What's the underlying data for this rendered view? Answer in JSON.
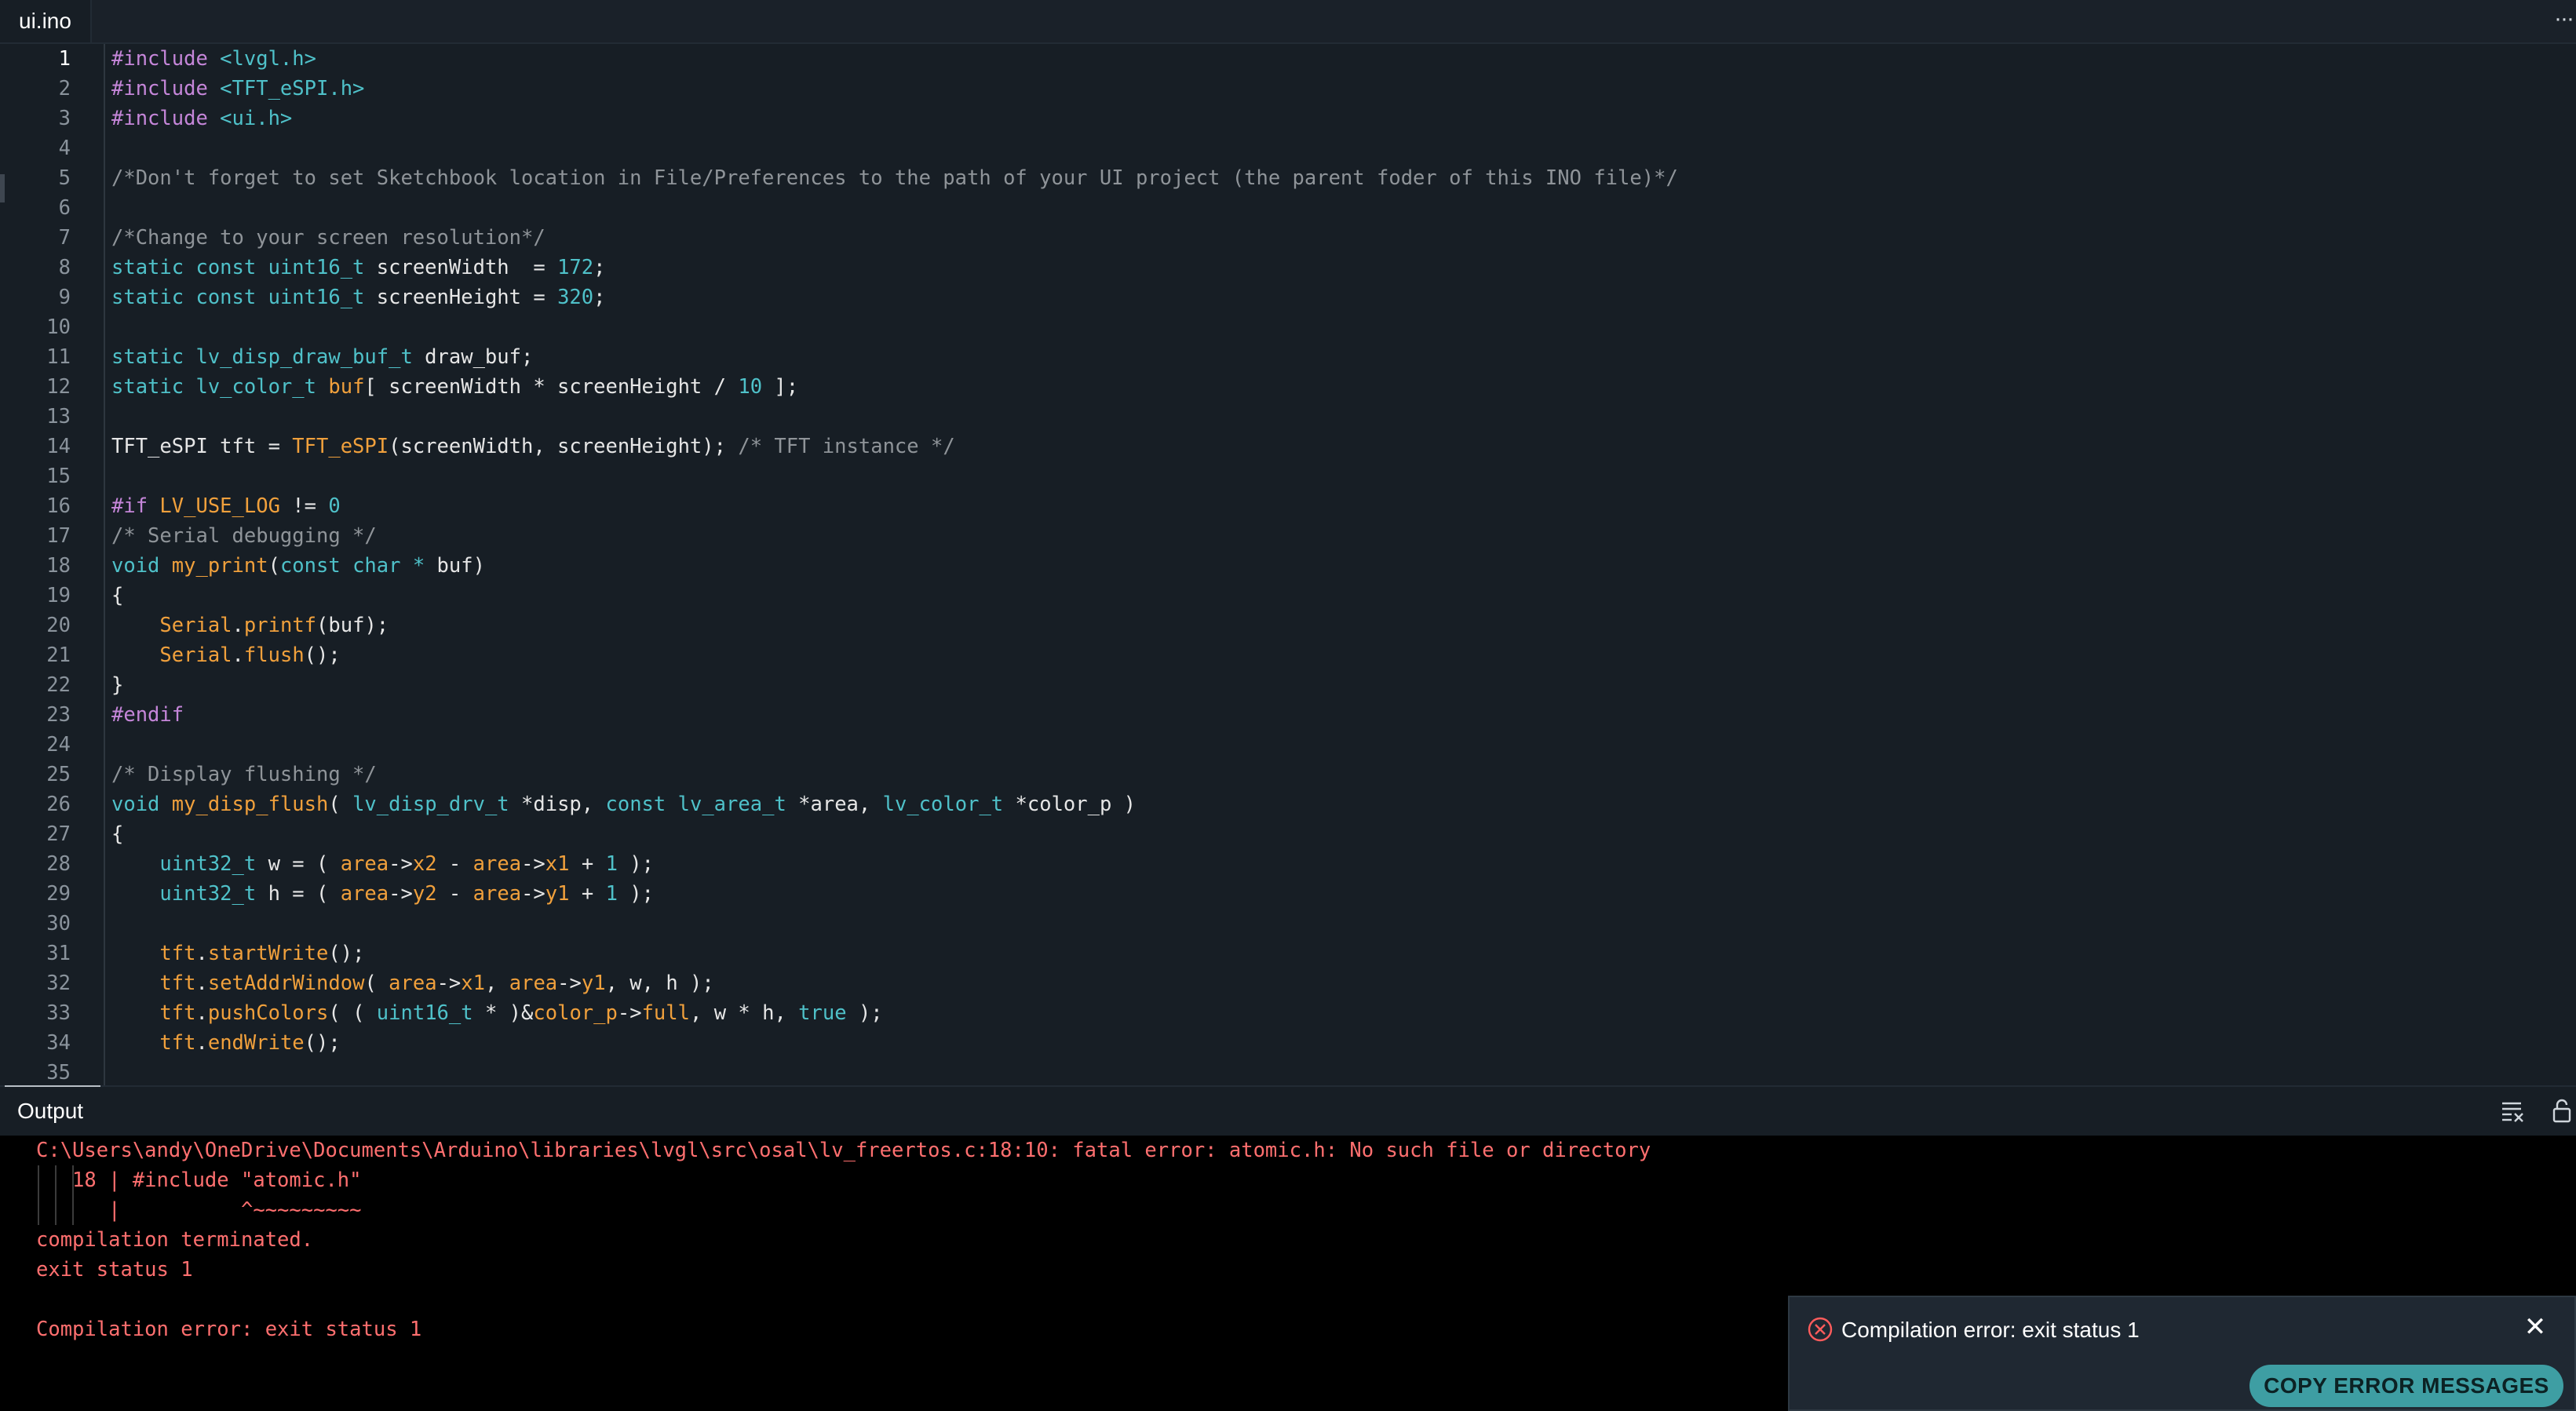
{
  "tab": {
    "label": "ui.ino"
  },
  "output_panel": {
    "title": "Output",
    "lines": [
      "C:\\Users\\andy\\OneDrive\\Documents\\Arduino\\libraries\\lvgl\\src\\osal\\lv_freertos.c:18:10: fatal error: atomic.h: No such file or directory",
      "   18 | #include \"atomic.h\"",
      "      |          ^~~~~~~~~~",
      "compilation terminated.",
      "exit status 1",
      "",
      "Compilation error: exit status 1"
    ]
  },
  "toast": {
    "message": "Compilation error: exit status 1",
    "button_label": "COPY ERROR MESSAGES"
  },
  "colors": {
    "editor_bg": "#171e25",
    "output_bg": "#000000",
    "error_text": "#ff6f6f",
    "button_bg": "#3e9ea3"
  },
  "icons": [
    "more-icon",
    "clear-output-icon",
    "lock-icon",
    "error-circle-icon",
    "close-icon"
  ],
  "editor": {
    "active_line": 1,
    "lines": [
      [
        [
          "inc",
          "#include "
        ],
        [
          "str",
          "<lvgl.h>"
        ]
      ],
      [
        [
          "inc",
          "#include "
        ],
        [
          "str",
          "<TFT_eSPI.h>"
        ]
      ],
      [
        [
          "inc",
          "#include "
        ],
        [
          "str",
          "<ui.h>"
        ]
      ],
      [],
      [
        [
          "com",
          "/*Don't forget to set Sketchbook location in File/Preferences to the path of your UI project (the parent foder of this INO file)*/"
        ]
      ],
      [],
      [
        [
          "com",
          "/*Change to your screen resolution*/"
        ]
      ],
      [
        [
          "kw",
          "static const "
        ],
        [
          "typ",
          "uint16_t"
        ],
        [
          "def",
          " screenWidth  = "
        ],
        [
          "num",
          "172"
        ],
        [
          "def",
          ";"
        ]
      ],
      [
        [
          "kw",
          "static const "
        ],
        [
          "typ",
          "uint16_t"
        ],
        [
          "def",
          " screenHeight = "
        ],
        [
          "num",
          "320"
        ],
        [
          "def",
          ";"
        ]
      ],
      [],
      [
        [
          "kw",
          "static "
        ],
        [
          "typ",
          "lv_disp_draw_buf_t"
        ],
        [
          "def",
          " draw_buf;"
        ]
      ],
      [
        [
          "kw",
          "static "
        ],
        [
          "typ",
          "lv_color_t"
        ],
        [
          "def",
          " "
        ],
        [
          "fn",
          "buf"
        ],
        [
          "def",
          "[ screenWidth * screenHeight / "
        ],
        [
          "num",
          "10"
        ],
        [
          "def",
          " ];"
        ]
      ],
      [],
      [
        [
          "def",
          "TFT_eSPI tft = "
        ],
        [
          "fn",
          "TFT_eSPI"
        ],
        [
          "def",
          "(screenWidth, screenHeight); "
        ],
        [
          "com",
          "/* TFT instance */"
        ]
      ],
      [],
      [
        [
          "inc",
          "#if "
        ],
        [
          "mac",
          "LV_USE_LOG"
        ],
        [
          "def",
          " != "
        ],
        [
          "num",
          "0"
        ]
      ],
      [
        [
          "com",
          "/* Serial debugging */"
        ]
      ],
      [
        [
          "kw",
          "void "
        ],
        [
          "fn",
          "my_print"
        ],
        [
          "def",
          "("
        ],
        [
          "kw",
          "const char * "
        ],
        [
          "def",
          "buf)"
        ]
      ],
      [
        [
          "def",
          "{"
        ]
      ],
      [
        [
          "def",
          "    "
        ],
        [
          "fn",
          "Serial"
        ],
        [
          "def",
          "."
        ],
        [
          "fn",
          "printf"
        ],
        [
          "def",
          "(buf);"
        ]
      ],
      [
        [
          "def",
          "    "
        ],
        [
          "fn",
          "Serial"
        ],
        [
          "def",
          "."
        ],
        [
          "fn",
          "flush"
        ],
        [
          "def",
          "();"
        ]
      ],
      [
        [
          "def",
          "}"
        ]
      ],
      [
        [
          "inc",
          "#endif"
        ]
      ],
      [],
      [
        [
          "com",
          "/* Display flushing */"
        ]
      ],
      [
        [
          "kw",
          "void "
        ],
        [
          "fn",
          "my_disp_flush"
        ],
        [
          "def",
          "( "
        ],
        [
          "typ",
          "lv_disp_drv_t"
        ],
        [
          "def",
          " *disp, "
        ],
        [
          "kw",
          "const "
        ],
        [
          "typ",
          "lv_area_t"
        ],
        [
          "def",
          " *area, "
        ],
        [
          "typ",
          "lv_color_t"
        ],
        [
          "def",
          " *color_p )"
        ]
      ],
      [
        [
          "def",
          "{"
        ]
      ],
      [
        [
          "def",
          "    "
        ],
        [
          "typ",
          "uint32_t"
        ],
        [
          "def",
          " w = ( "
        ],
        [
          "fn",
          "area"
        ],
        [
          "def",
          "->"
        ],
        [
          "fn",
          "x2"
        ],
        [
          "def",
          " - "
        ],
        [
          "fn",
          "area"
        ],
        [
          "def",
          "->"
        ],
        [
          "fn",
          "x1"
        ],
        [
          "def",
          " + "
        ],
        [
          "num",
          "1"
        ],
        [
          "def",
          " );"
        ]
      ],
      [
        [
          "def",
          "    "
        ],
        [
          "typ",
          "uint32_t"
        ],
        [
          "def",
          " h = ( "
        ],
        [
          "fn",
          "area"
        ],
        [
          "def",
          "->"
        ],
        [
          "fn",
          "y2"
        ],
        [
          "def",
          " - "
        ],
        [
          "fn",
          "area"
        ],
        [
          "def",
          "->"
        ],
        [
          "fn",
          "y1"
        ],
        [
          "def",
          " + "
        ],
        [
          "num",
          "1"
        ],
        [
          "def",
          " );"
        ]
      ],
      [],
      [
        [
          "def",
          "    "
        ],
        [
          "fn",
          "tft"
        ],
        [
          "def",
          "."
        ],
        [
          "fn",
          "startWrite"
        ],
        [
          "def",
          "();"
        ]
      ],
      [
        [
          "def",
          "    "
        ],
        [
          "fn",
          "tft"
        ],
        [
          "def",
          "."
        ],
        [
          "fn",
          "setAddrWindow"
        ],
        [
          "def",
          "( "
        ],
        [
          "fn",
          "area"
        ],
        [
          "def",
          "->"
        ],
        [
          "fn",
          "x1"
        ],
        [
          "def",
          ", "
        ],
        [
          "fn",
          "area"
        ],
        [
          "def",
          "->"
        ],
        [
          "fn",
          "y1"
        ],
        [
          "def",
          ", w, h );"
        ]
      ],
      [
        [
          "def",
          "    "
        ],
        [
          "fn",
          "tft"
        ],
        [
          "def",
          "."
        ],
        [
          "fn",
          "pushColors"
        ],
        [
          "def",
          "( ( "
        ],
        [
          "typ",
          "uint16_t"
        ],
        [
          "def",
          " * )&"
        ],
        [
          "fn",
          "color_p"
        ],
        [
          "def",
          "->"
        ],
        [
          "fn",
          "full"
        ],
        [
          "def",
          ", w * h, "
        ],
        [
          "kw",
          "true"
        ],
        [
          "def",
          " );"
        ]
      ],
      [
        [
          "def",
          "    "
        ],
        [
          "fn",
          "tft"
        ],
        [
          "def",
          "."
        ],
        [
          "fn",
          "endWrite"
        ],
        [
          "def",
          "();"
        ]
      ],
      []
    ]
  }
}
